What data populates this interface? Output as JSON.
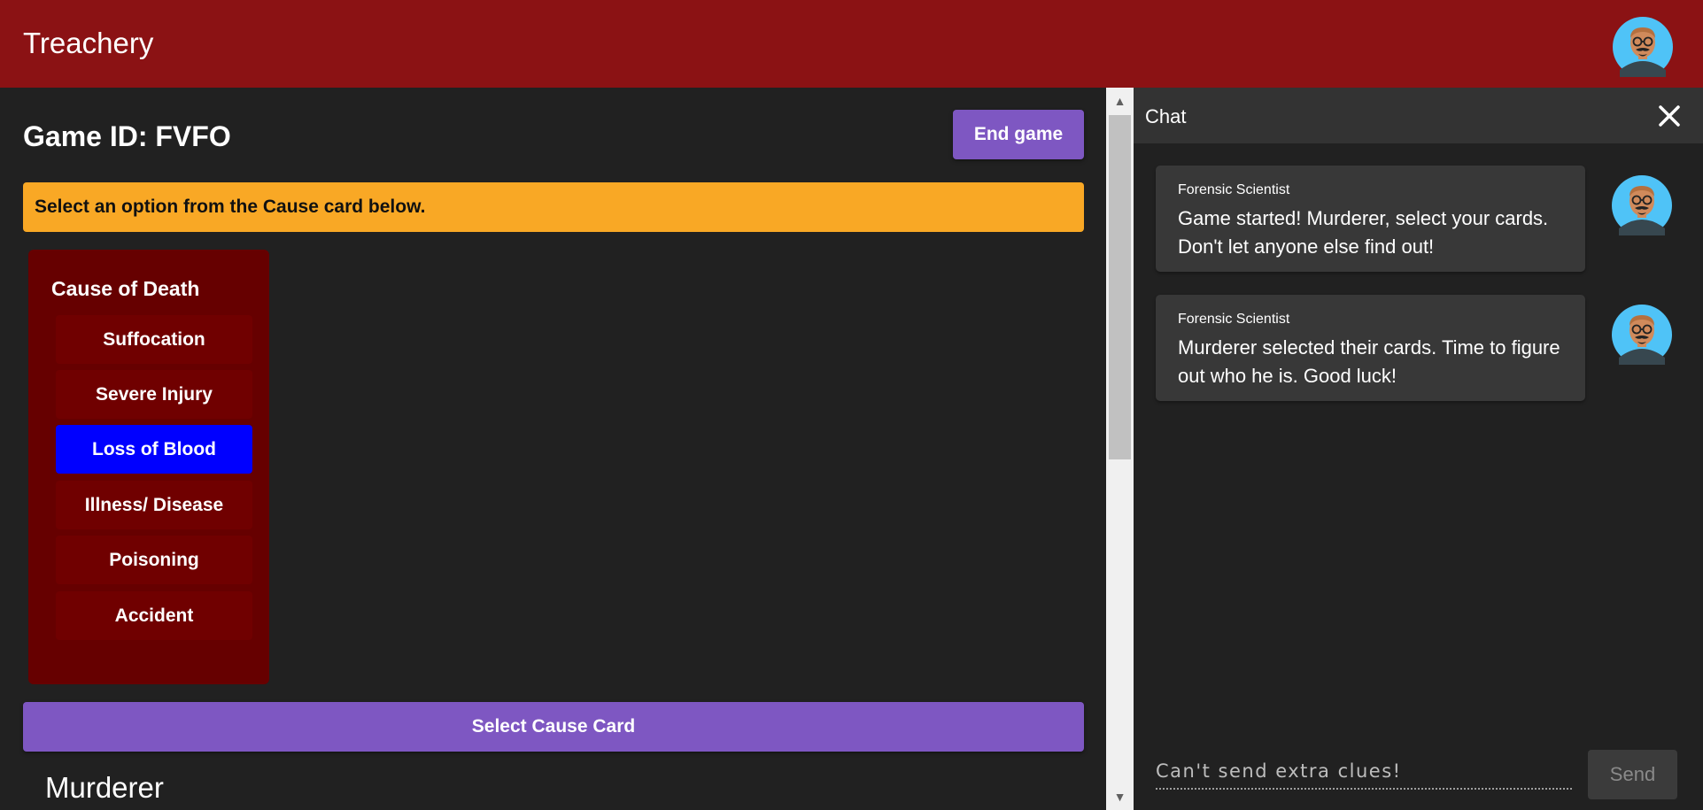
{
  "app": {
    "title": "Treachery"
  },
  "game": {
    "id_label": "Game ID: FVFO",
    "end_button": "End game",
    "instruction": "Select an option from the Cause card below.",
    "select_button": "Select Cause Card",
    "section_heading": "Murderer"
  },
  "card": {
    "title": "Cause of Death",
    "options": [
      {
        "label": "Suffocation",
        "selected": false
      },
      {
        "label": "Severe Injury",
        "selected": false
      },
      {
        "label": "Loss of Blood",
        "selected": true
      },
      {
        "label": "Illness/ Disease",
        "selected": false
      },
      {
        "label": "Poisoning",
        "selected": false
      },
      {
        "label": "Accident",
        "selected": false
      }
    ]
  },
  "chat": {
    "title": "Chat",
    "messages": [
      {
        "author": "Forensic Scientist",
        "text": "Game started! Murderer, select your cards. Don't let anyone else find out!"
      },
      {
        "author": "Forensic Scientist",
        "text": "Murderer selected their cards. Time to figure out who he is. Good luck!"
      }
    ],
    "input_placeholder": "Can't send extra clues!",
    "send_button": "Send"
  },
  "colors": {
    "topbar": "#8b1214",
    "primary": "#7e57c2",
    "alert": "#f9a825",
    "card": "#660000",
    "selected_option": "#0000ff",
    "avatar_bg": "#4fc3f7"
  },
  "icons": {
    "avatar": "avatar-icon",
    "close": "close-icon",
    "scroll_up": "scroll-up-arrow-icon",
    "scroll_down": "scroll-down-arrow-icon"
  }
}
